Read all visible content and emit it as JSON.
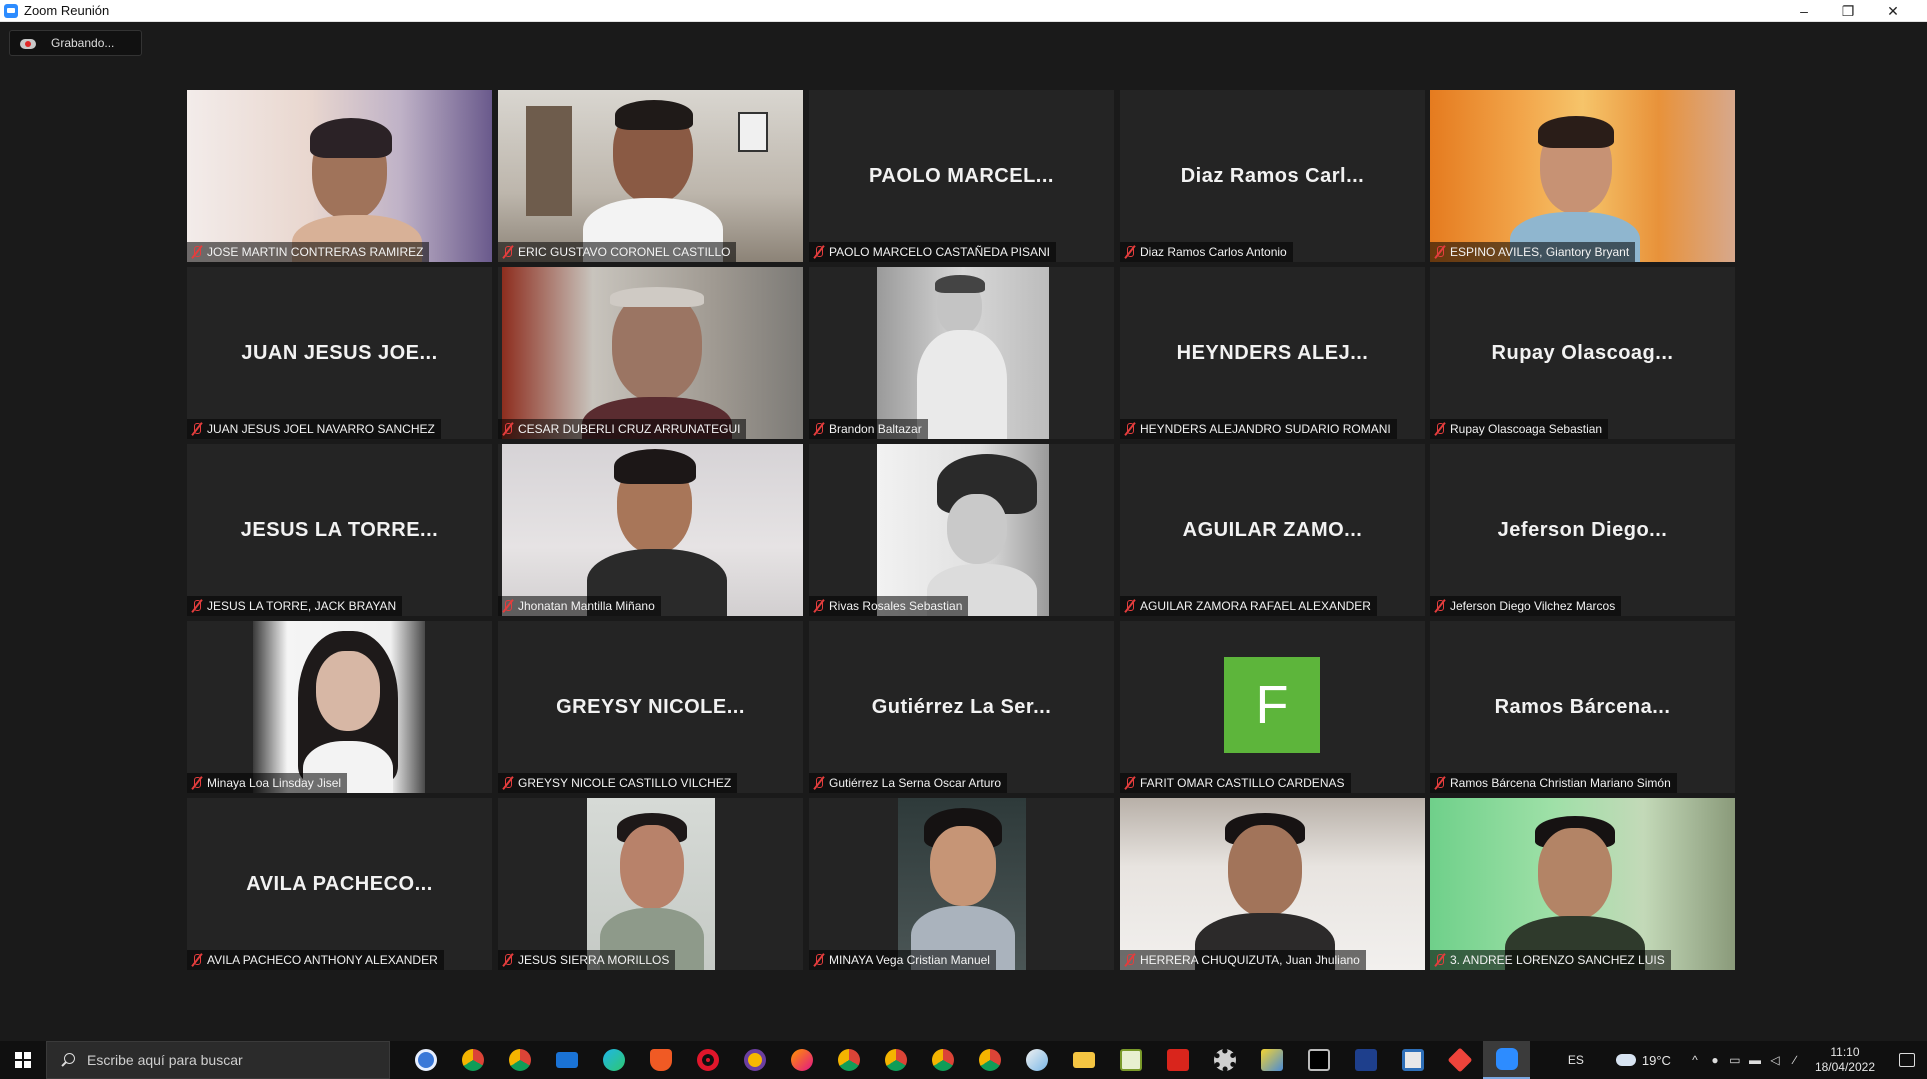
{
  "window": {
    "title": "Zoom Reunión",
    "minimize": "–",
    "restore": "❐",
    "close": "✕"
  },
  "recording": {
    "label": "Grabando..."
  },
  "participants": [
    {
      "name": "JOSE MARTIN CONTRERAS RAMIREZ",
      "display": "",
      "muted": true
    },
    {
      "name": "ERIC GUSTAVO CORONEL CASTILLO",
      "display": "",
      "muted": true,
      "speaking": true
    },
    {
      "name": "PAOLO MARCELO CASTAÑEDA PISANI",
      "display": "PAOLO MARCEL...",
      "muted": true
    },
    {
      "name": "Diaz Ramos Carlos Antonio",
      "display": "Diaz Ramos Carl...",
      "muted": true
    },
    {
      "name": "ESPINO AVILES, Giantory Bryant",
      "display": "",
      "muted": true
    },
    {
      "name": "JUAN JESUS JOEL NAVARRO SANCHEZ",
      "display": "JUAN JESUS JOE...",
      "muted": true
    },
    {
      "name": "CESAR DUBERLI CRUZ ARRUNATEGUI",
      "display": "",
      "muted": true
    },
    {
      "name": "Brandon Baltazar",
      "display": "",
      "muted": true
    },
    {
      "name": "HEYNDERS ALEJANDRO SUDARIO ROMANI",
      "display": "HEYNDERS ALEJ...",
      "muted": true
    },
    {
      "name": "Rupay Olascoaga Sebastian",
      "display": "Rupay Olascoag...",
      "muted": true
    },
    {
      "name": "JESUS LA TORRE, JACK BRAYAN",
      "display": "JESUS LA TORRE...",
      "muted": true
    },
    {
      "name": "Jhonatan Mantilla Miñano",
      "display": "",
      "muted": true
    },
    {
      "name": "Rivas Rosales Sebastian",
      "display": "",
      "muted": true
    },
    {
      "name": "AGUILAR ZAMORA RAFAEL ALEXANDER",
      "display": "AGUILAR ZAMO...",
      "muted": true
    },
    {
      "name": "Jeferson Diego Vilchez Marcos",
      "display": "Jeferson Diego...",
      "muted": true
    },
    {
      "name": "Minaya Loa Linsday Jisel",
      "display": "",
      "muted": true
    },
    {
      "name": "GREYSY NICOLE CASTILLO VILCHEZ",
      "display": "GREYSY NICOLE...",
      "muted": true
    },
    {
      "name": "Gutiérrez La Serna Oscar Arturo",
      "display": "Gutiérrez La Ser...",
      "muted": true
    },
    {
      "name": "FARIT OMAR CASTILLO CARDENAS",
      "display": "",
      "avatar_letter": "F",
      "muted": true
    },
    {
      "name": "Ramos Bárcena Christian Mariano Simón",
      "display": "Ramos Bárcena...",
      "muted": true
    },
    {
      "name": "AVILA PACHECO ANTHONY ALEXANDER",
      "display": "AVILA PACHECO...",
      "muted": true
    },
    {
      "name": "JESUS SIERRA MORILLOS",
      "display": "",
      "muted": true
    },
    {
      "name": "MINAYA Vega Cristian Manuel",
      "display": "",
      "muted": true
    },
    {
      "name": "HERRERA CHUQUIZUTA, Juan Jhuliano",
      "display": "",
      "muted": true
    },
    {
      "name": "3. ANDREE LORENZO SANCHEZ LUIS",
      "display": "",
      "muted": true
    }
  ],
  "taskbar": {
    "search_placeholder": "Escribe aquí para buscar",
    "language": "ES",
    "temperature": "19°C",
    "time": "11:10",
    "date": "18/04/2022"
  },
  "colors": {
    "background": "#1a1a1a",
    "tile": "#242424",
    "active_speaker_border": "#b8d84a",
    "mute": "#e43d3d",
    "avatar_green": "#5db53b"
  }
}
